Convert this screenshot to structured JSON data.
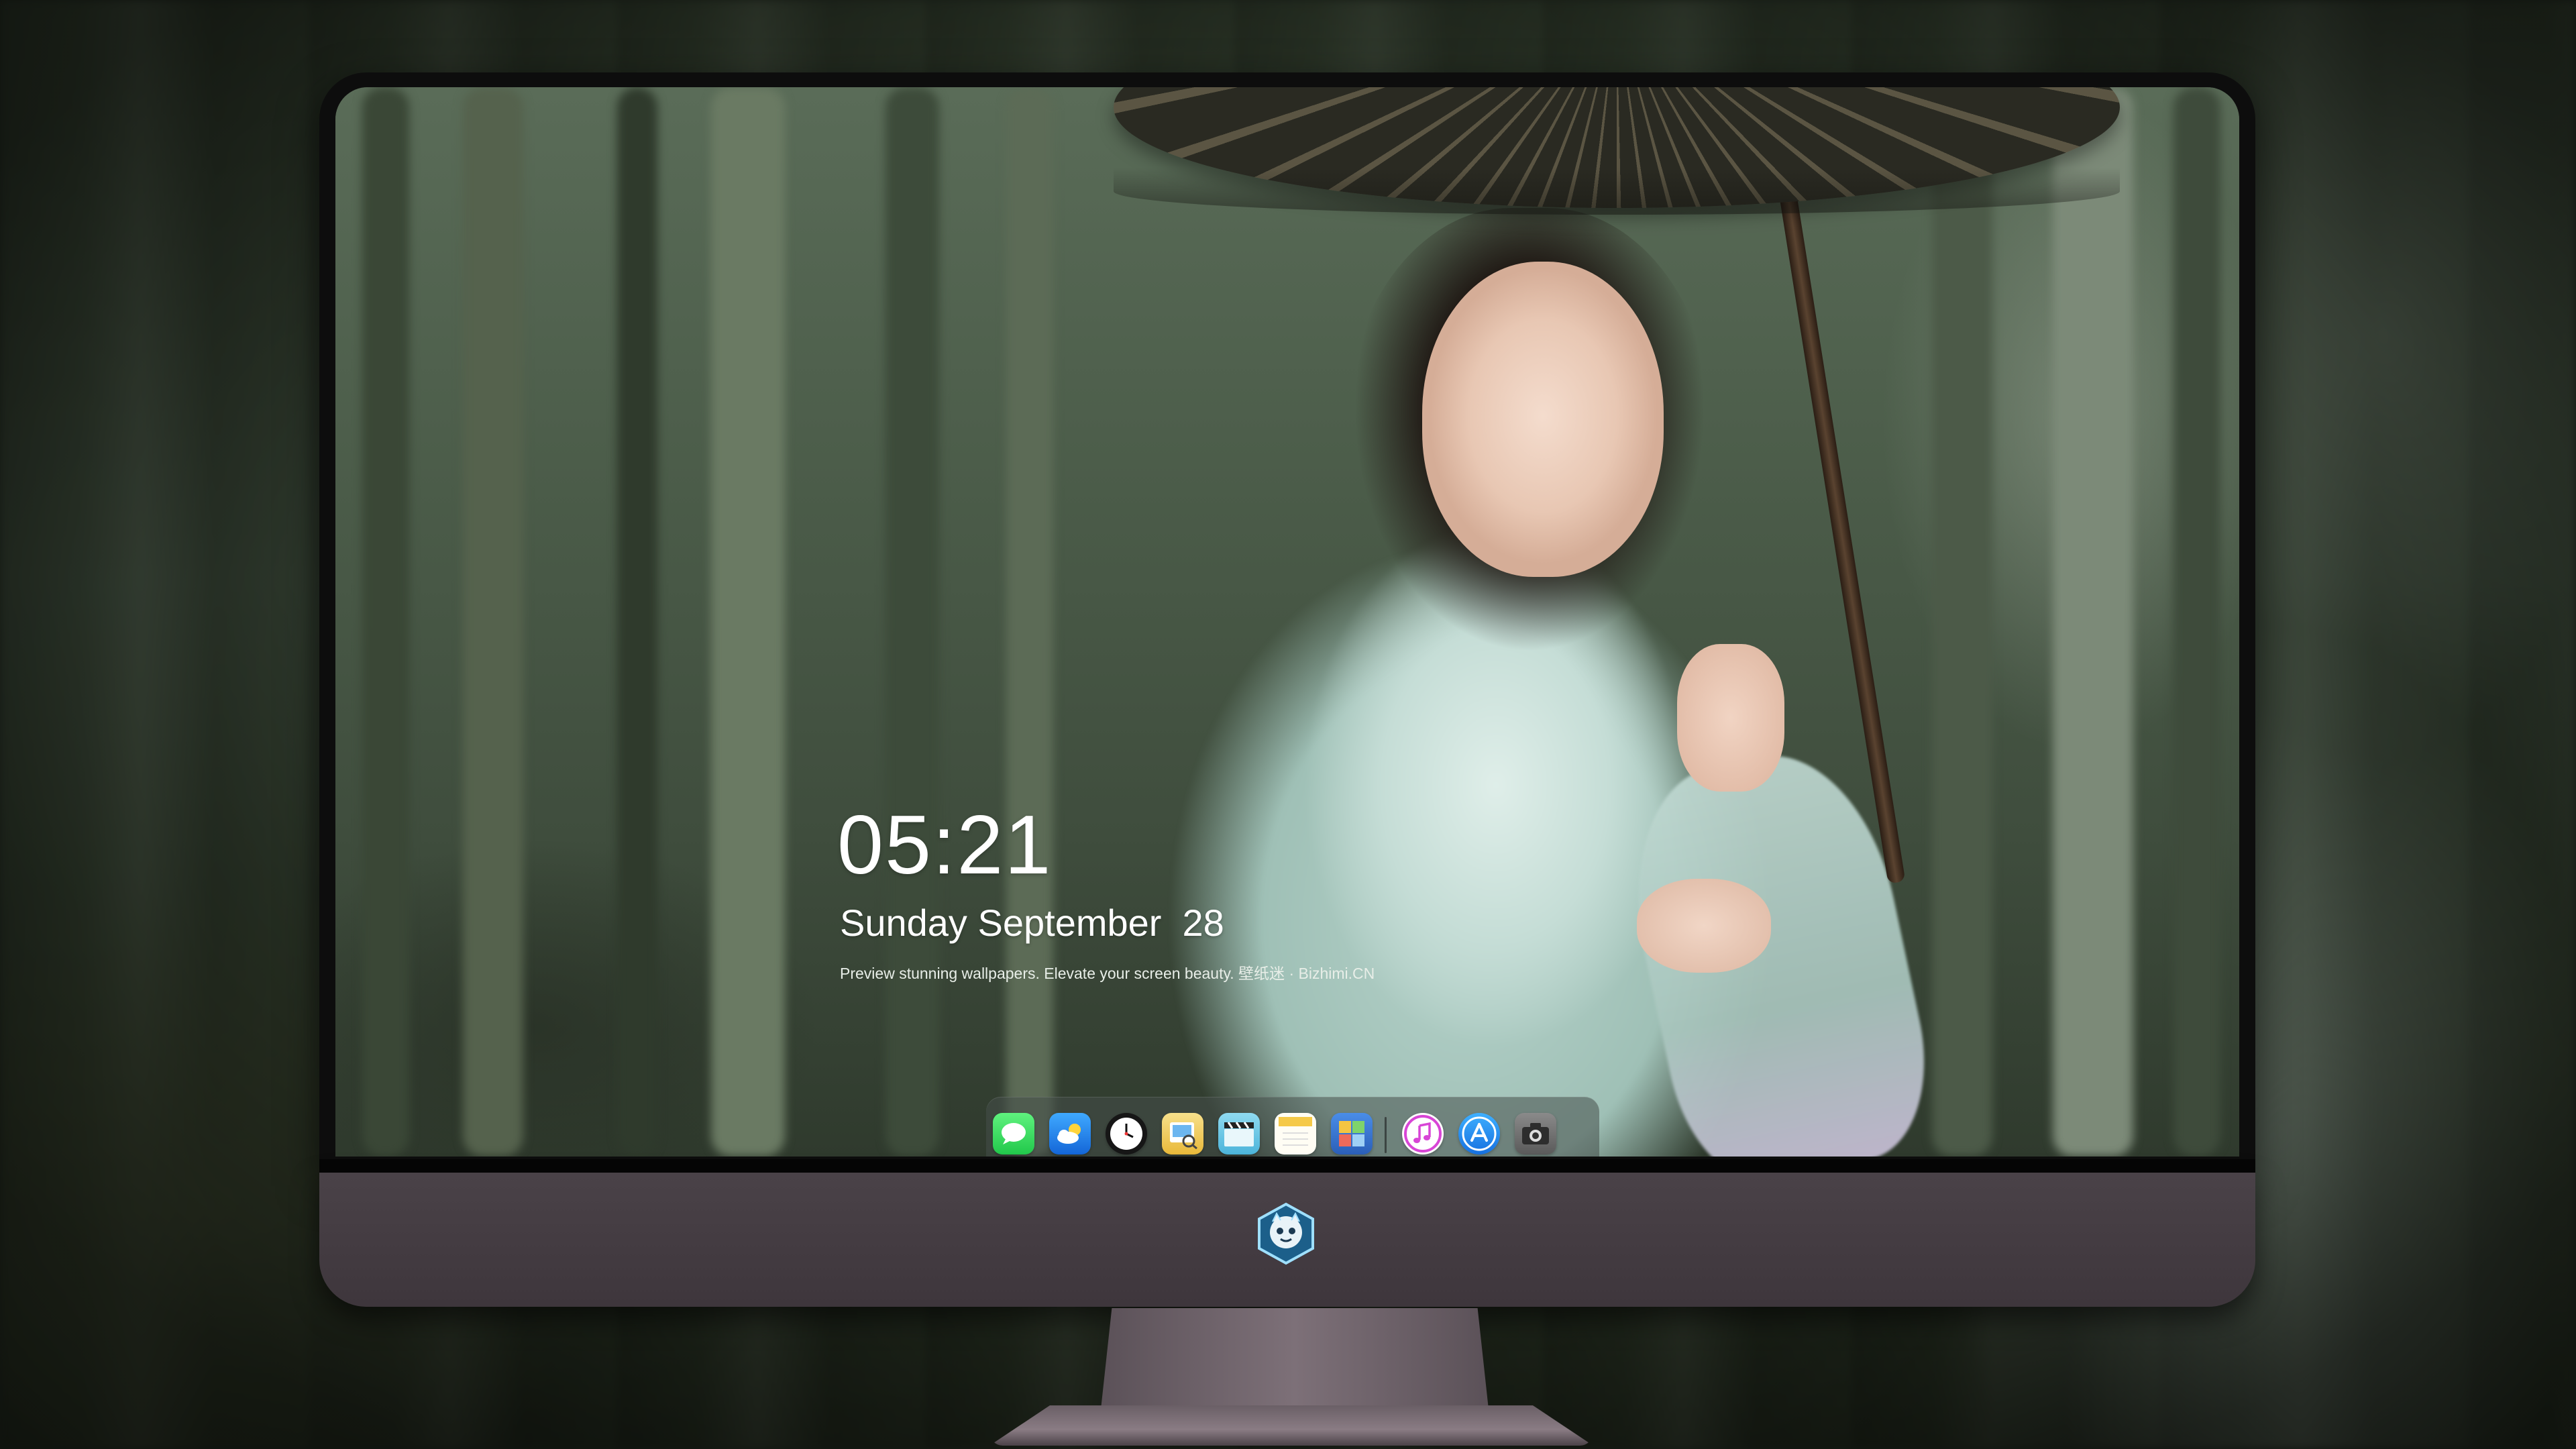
{
  "lockscreen": {
    "time": "05:21",
    "date": "Sunday September  28",
    "tagline": "Preview stunning wallpapers. Elevate your screen beauty. 壁纸迷 · Bizhimi.CN"
  },
  "dock": {
    "apps": [
      {
        "name": "messages-icon",
        "color": "#2fd158"
      },
      {
        "name": "weather-icon",
        "color": "#1f8cf0"
      },
      {
        "name": "clock-icon",
        "color": "#1a1a1a"
      },
      {
        "name": "preview-icon",
        "color": "#f2c94c"
      },
      {
        "name": "imovie-icon",
        "color": "#69c7e3"
      },
      {
        "name": "notes-icon",
        "color": "#f7d35e"
      },
      {
        "name": "photo-booth-icon",
        "color": "#3b79d8"
      },
      {
        "name": "music-icon",
        "color": "#d94adf"
      },
      {
        "name": "app-store-icon",
        "color": "#2a8cf5"
      },
      {
        "name": "camera-icon",
        "color": "#6b6b6b"
      }
    ]
  },
  "colors": {
    "bezel": "#0d0d0d",
    "chin": "#3e363c",
    "text": "#ffffff"
  }
}
